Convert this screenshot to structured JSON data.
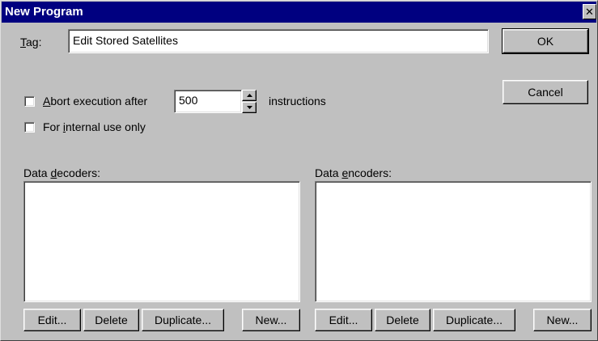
{
  "window": {
    "title": "New Program",
    "close_glyph": "✕"
  },
  "tag": {
    "label_mnemonic": "T",
    "label_rest": "ag:",
    "value": "Edit Stored Satellites"
  },
  "buttons": {
    "ok": "OK",
    "cancel": "Cancel"
  },
  "abort": {
    "checked": false,
    "label_mnemonic": "A",
    "label_rest": "bort execution after",
    "value": "500",
    "suffix": "instructions"
  },
  "internal": {
    "checked": false,
    "label_pre": "For ",
    "label_mnemonic": "i",
    "label_rest": "nternal use only"
  },
  "decoders": {
    "label_pre": "Data ",
    "label_mnemonic": "d",
    "label_rest": "ecoders:",
    "items": [],
    "buttons": {
      "edit": "Edit...",
      "delete": "Delete",
      "duplicate": "Duplicate...",
      "new": "New..."
    }
  },
  "encoders": {
    "label_pre": "Data ",
    "label_mnemonic": "e",
    "label_rest": "ncoders:",
    "items": [],
    "buttons": {
      "edit": "Edit...",
      "delete": "Delete",
      "duplicate": "Duplicate...",
      "new": "New..."
    }
  },
  "icons": {
    "close": "close-icon",
    "spin_up": "up-arrow-icon",
    "spin_down": "down-arrow-icon"
  }
}
